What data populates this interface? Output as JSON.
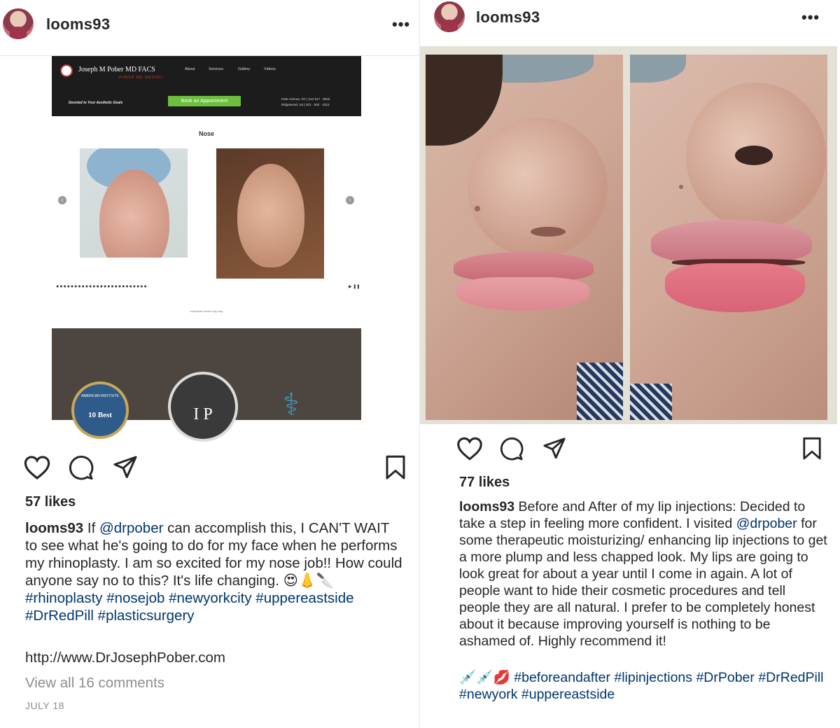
{
  "left_post": {
    "username": "looms93",
    "more_label": "•••",
    "website": {
      "logo": "Joseph M Pober MD FACS",
      "logo_sub": "POBER MD MEDSPA",
      "menu": [
        "About",
        "Services",
        "Gallery",
        "Videos"
      ],
      "tagline": "Devoted to Your Aesthetic Goals",
      "book_button": "Book an Appointment",
      "contact_1": "Park Avenue, NY | 212 517 · 9042",
      "contact_2": "Ridgewood, NJ | 201 · 652 · 4313",
      "section_title": "Nose",
      "prev_arrow": "‹",
      "next_arrow": "›",
      "carousel_dots": "●●●●●●●●●●●●●●●●●●●●●●●●●",
      "play_controls": "▶ ❚❚",
      "fine_print": "Individual results may vary",
      "badge_1_text": "10 Best",
      "badge_1_arc": "AMERICAN INSTITUTE",
      "badge_2_text": "I P"
    },
    "likes": "57 likes",
    "caption_user": "looms93",
    "caption_before_mention": " If ",
    "mention": "@drpober",
    "caption_text": " can accomplish this, I CAN'T WAIT to see what he's going to do for my face when he performs my rhinoplasty. I am so excited for my nose job!! How could anyone say no to this? It's life changing. 😍👃🔪 ",
    "hashtags": "#rhinoplasty #nosejob #newyorkcity #uppereastside #DrRedPill #plasticsurgery",
    "url": "http://www.DrJosephPober.com",
    "view_comments": "View all 16 comments",
    "date": "JULY 18"
  },
  "right_post": {
    "username": "looms93",
    "more_label": "•••",
    "likes": "77 likes",
    "caption_user": "looms93",
    "caption_part1": " Before and After of my lip injections: Decided to take a step in feeling more confident. I visited ",
    "mention": "@drpober",
    "caption_part2": " for some therapeutic moisturizing/ enhancing lip injections to get a more plump and less chapped look. My lips are going to look great for about a year until I come in again. A lot of people want to hide their cosmetic procedures and tell people they are all natural. I prefer to be completely honest about it because improving yourself is nothing to be ashamed of. Highly recommend it!",
    "emojis": "💉💉💋 ",
    "hashtags": "#beforeandafter #lipinjections #DrPober #DrRedPill #newyork #uppereastside"
  },
  "icons": {
    "like": "heart-icon",
    "comment": "comment-icon",
    "share": "share-icon",
    "save": "bookmark-icon"
  },
  "colors": {
    "text": "#262626",
    "link": "#00376b",
    "muted": "#8e8e8e",
    "book_button": "#6bbf3d"
  }
}
